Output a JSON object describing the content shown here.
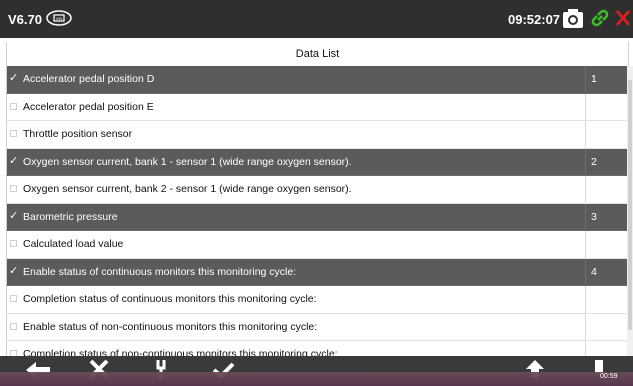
{
  "topbar": {
    "version": "V6.70",
    "time": "09:52:07"
  },
  "list_header": "Data List",
  "rows": [
    {
      "label": "Accelerator pedal position D",
      "selected": true,
      "number": "1"
    },
    {
      "label": "Accelerator pedal position E",
      "selected": false,
      "number": ""
    },
    {
      "label": "Throttle position sensor",
      "selected": false,
      "number": ""
    },
    {
      "label": "Oxygen sensor current, bank 1 - sensor 1 (wide range oxygen sensor).",
      "selected": true,
      "number": "2"
    },
    {
      "label": "Oxygen sensor current, bank 2 - sensor 1 (wide range oxygen sensor).",
      "selected": false,
      "number": ""
    },
    {
      "label": "Barometric pressure",
      "selected": true,
      "number": "3"
    },
    {
      "label": "Calculated load value",
      "selected": false,
      "number": ""
    },
    {
      "label": "Enable status of continuous monitors this monitoring cycle:",
      "selected": true,
      "number": "4"
    },
    {
      "label": "Completion status of continuous monitors this monitoring cycle:",
      "selected": false,
      "number": ""
    },
    {
      "label": "Enable status of non-continuous monitors this monitoring cycle:",
      "selected": false,
      "number": ""
    },
    {
      "label": "Completion status of non-continuous monitors this monitoring cycle:",
      "selected": false,
      "number": ""
    }
  ],
  "taskbar": {
    "time": "00:59"
  },
  "colors": {
    "topbar": "#2f2f2f",
    "selected_row": "#5b5b5b",
    "close": "#e0201c",
    "link": "#3bbf2a"
  }
}
